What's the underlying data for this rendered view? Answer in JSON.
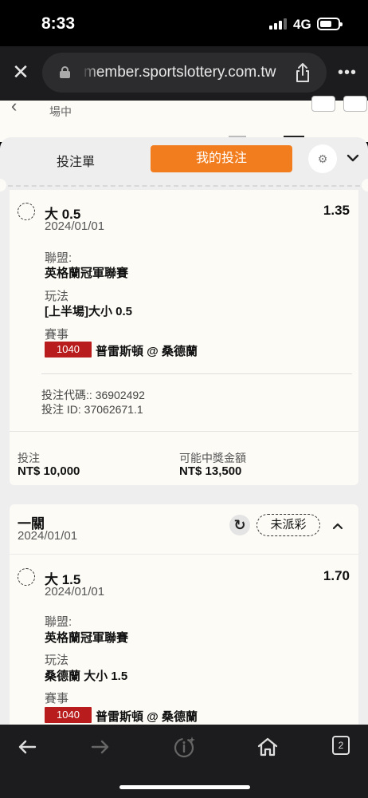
{
  "status_bar": {
    "time": "8:33",
    "network": "4G"
  },
  "browser": {
    "url": "member.sportslottery.com.tw",
    "tab_count": "2"
  },
  "page_behind": {
    "subtitle": "場中"
  },
  "sheet": {
    "tab_bet_slip": "投注單",
    "tab_my_bets": "我的投注"
  },
  "bet1": {
    "selection": "大 0.5",
    "date": "2024/01/01",
    "odds": "1.35",
    "league_label": "聯盟:",
    "league": "英格蘭冠軍聯賽",
    "market_label": "玩法",
    "market": "[上半場]大小 0.5",
    "event_label": "賽事",
    "event_code": "1040",
    "event": "普雷斯頓 @ 桑德蘭",
    "bet_code": "投注代碼:: 36902492",
    "bet_id": "投注 ID: 37062671.1",
    "stake_label": "投注",
    "stake": "NT$ 10,000",
    "payout_label": "可能中獎金額",
    "payout": "NT$ 13,500"
  },
  "bet2": {
    "type": "一關",
    "header_date": "2024/01/01",
    "status": "未派彩",
    "selection": "大 1.5",
    "date": "2024/01/01",
    "odds": "1.70",
    "league_label": "聯盟:",
    "league": "英格蘭冠軍聯賽",
    "market_label": "玩法",
    "market": "桑德蘭 大小 1.5",
    "event_label": "賽事",
    "event_code": "1040",
    "event": "普雷斯頓 @ 桑德蘭"
  },
  "colors": {
    "accent": "#f27d1e",
    "code_red": "#b81c1c",
    "card_bg": "#fcfbf6"
  },
  "icons": [
    "close-icon",
    "lock-icon",
    "share-icon",
    "more-icon",
    "gear-icon",
    "chevron-down-icon",
    "refresh-icon",
    "chevron-up-icon",
    "back-icon",
    "forward-icon",
    "info-sparkle-icon",
    "home-icon",
    "tabs-icon"
  ]
}
